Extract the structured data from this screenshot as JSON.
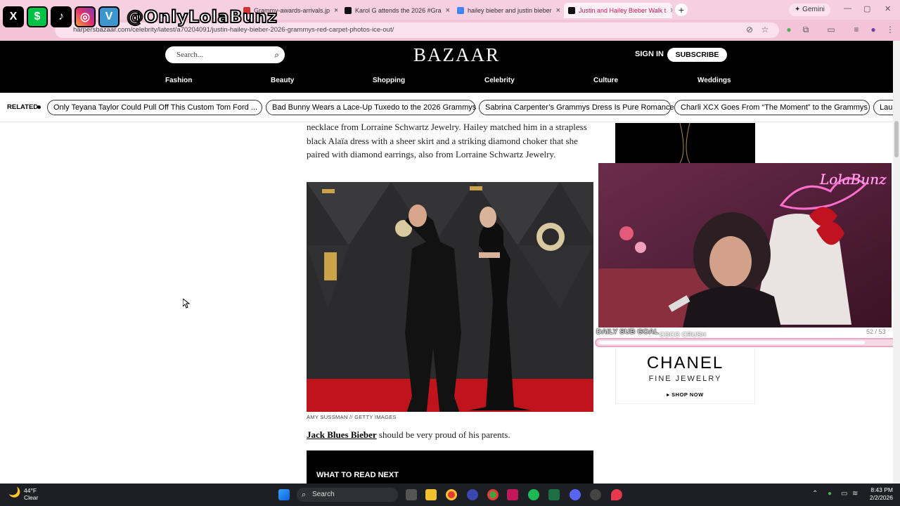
{
  "browser": {
    "tabs": [
      {
        "label": "Grammy-awards-arrivals.jp",
        "active": false
      },
      {
        "label": "Karol G attends the 2026 #Gra",
        "active": false
      },
      {
        "label": "hailey bieber and justin bieber",
        "active": false
      },
      {
        "label": "Justin and Hailey Bieber Walk t",
        "active": true
      }
    ],
    "gemini_label": "Gemini",
    "url": "harpersbazaar.com/celebrity/latest/a70204091/justin-hailey-bieber-2026-grammys-red-carpet-photos-ice-out/"
  },
  "overlay": {
    "handle": "@OnlyLolaBunz",
    "social_icons": [
      "x-icon",
      "cashapp-icon",
      "tiktok-icon",
      "instagram-icon",
      "venmo-icon"
    ],
    "sub_goal_label": "DAILY SUB GOAL",
    "sub_goal_name": "COCO CRUSH",
    "sub_goal_count": "52 / 53",
    "sub_goal_progress": 0.9
  },
  "site": {
    "search_placeholder": "Search...",
    "logo": "BAZAAR",
    "sign_in": "SIGN IN",
    "subscribe": "SUBSCRIBE",
    "nav": [
      "Fashion",
      "Beauty",
      "Shopping",
      "Celebrity",
      "Culture",
      "Weddings"
    ],
    "related_label": "RELATED",
    "related": [
      "Only Teyana Taylor Could Pull Off This Custom Tom Ford ...",
      "Bad Bunny Wears a Lace-Up Tuxedo to the 2026 Grammys",
      "Sabrina Carpenter’s Grammys Dress Is Pure Romance",
      "Charli XCX Goes From “The Moment” to the Grammys",
      "Laur"
    ]
  },
  "article": {
    "paragraph1": "necklace from Lorraine Schwartz Jewelry. Hailey matched him in a strapless black Alaïa dress with a sheer skirt and a striking diamond choker that she paired with diamond earrings, also from Lorraine Schwartz Jewelry.",
    "photo_credit": "AMY SUSSMAN // GETTY IMAGES",
    "paragraph2_link": "Jack Blues Bieber",
    "paragraph2_rest": " should be very proud of his parents.",
    "read_next": "WHAT TO READ NEXT"
  },
  "ad": {
    "brand": "CHANEL",
    "sub": "FINE JEWELRY",
    "cta": "▸ SHOP NOW"
  },
  "webcam": {
    "neon_text": "LolaBunz"
  },
  "taskbar": {
    "temperature": "44°F",
    "condition": "Clear",
    "search_placeholder": "Search",
    "time": "8:43 PM",
    "date": "2/2/2026"
  }
}
